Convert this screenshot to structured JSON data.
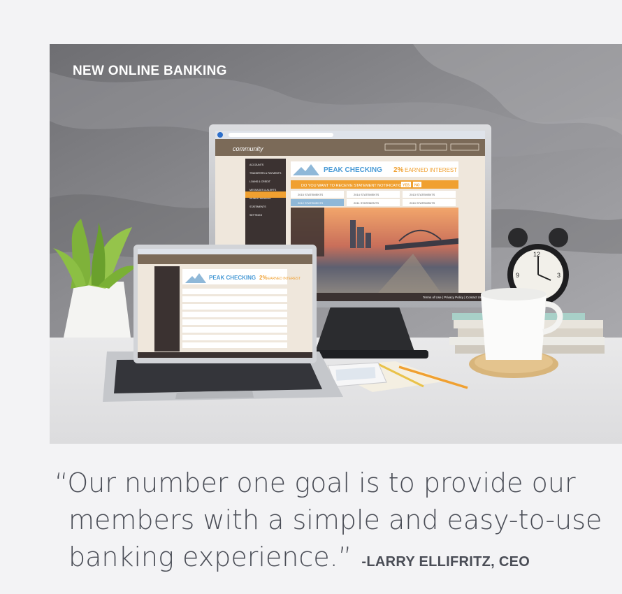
{
  "hero": {
    "title": "NEW ONLINE BANKING",
    "monitor_screen": {
      "brand": "community",
      "nav_items": [
        "ACCOUNTS",
        "TRANSFERS & PAYMENTS",
        "LOANS & CREDIT",
        "MESSAGES & ALERTS",
        "MOBILE BANKING",
        "STATEMENTS",
        "SETTINGS"
      ],
      "banner_product": "PEAK CHECKING",
      "banner_rate": "2%",
      "banner_rate_label": "EARNED INTEREST",
      "notify_question": "DO YOU WANT TO RECEIVE STATEMENT NOTIFICATIONS?",
      "yes_label": "YES",
      "no_label": "NO",
      "statement_years": [
        "2015 STATEMENTS",
        "2014 STATEMENTS",
        "2013 STATEMENTS",
        "2012 STATEMENTS",
        "2011 STATEMENTS",
        "2010 STATEMENTS"
      ],
      "footer_links": "Terms of Use | Privacy Policy | Contact Us"
    },
    "laptop_screen": {
      "banner_product": "PEAK CHECKING",
      "banner_rate": "2%",
      "banner_rate_label": "EARNED INTEREST"
    }
  },
  "quote": {
    "line1": "“Our number one goal is to provide our",
    "line2": "members with a simple and easy-to-use",
    "line3": "banking experience.”",
    "attribution": "-LARRY ELLIFRITZ, CEO"
  },
  "colors": {
    "accent_orange": "#f0a030",
    "accent_blue": "#4a9bd6",
    "text": "#4a4d56",
    "background": "#f3f3f5"
  }
}
